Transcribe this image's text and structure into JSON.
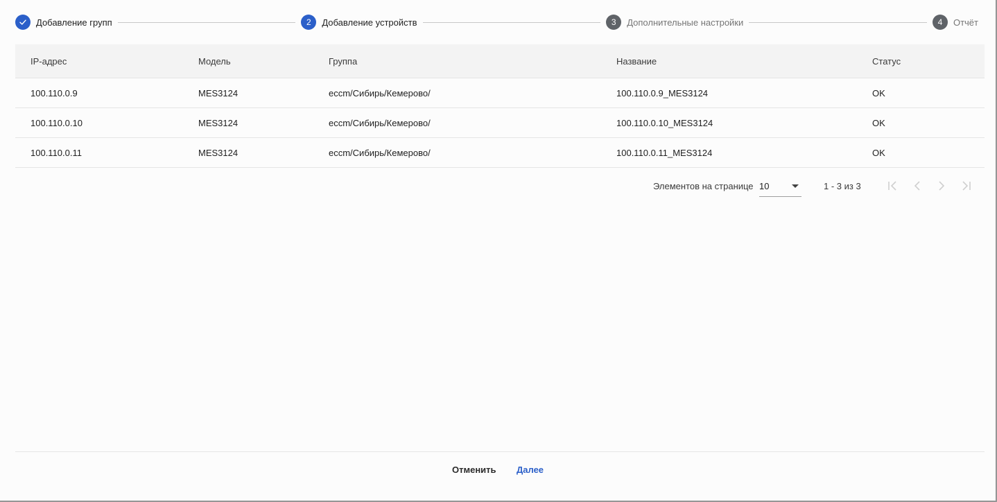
{
  "stepper": {
    "steps": [
      {
        "index": "1",
        "label": "Добавление групп",
        "state": "done"
      },
      {
        "index": "2",
        "label": "Добавление устройств",
        "state": "active"
      },
      {
        "index": "3",
        "label": "Дополнительные настройки",
        "state": "inactive"
      },
      {
        "index": "4",
        "label": "Отчёт",
        "state": "inactive"
      }
    ]
  },
  "table": {
    "headers": [
      "IP-адрес",
      "Модель",
      "Группа",
      "Название",
      "Статус"
    ],
    "rows": [
      [
        "100.110.0.9",
        "MES3124",
        "eccm/Сибирь/Кемерово/",
        "100.110.0.9_MES3124",
        "OK"
      ],
      [
        "100.110.0.10",
        "MES3124",
        "eccm/Сибирь/Кемерово/",
        "100.110.0.10_MES3124",
        "OK"
      ],
      [
        "100.110.0.11",
        "MES3124",
        "eccm/Сибирь/Кемерово/",
        "100.110.0.11_MES3124",
        "OK"
      ]
    ]
  },
  "paginator": {
    "page_size_label": "Элементов на странице",
    "page_size": "10",
    "range_label": "1 - 3 из 3",
    "icons": [
      "first-page-icon",
      "prev-page-icon",
      "next-page-icon",
      "last-page-icon"
    ]
  },
  "footer": {
    "cancel_label": "Отменить",
    "next_label": "Далее"
  },
  "colors": {
    "accent": "#2b5fc9",
    "inactive_step": "#5f6368",
    "header_bg": "#f3f3f3"
  }
}
